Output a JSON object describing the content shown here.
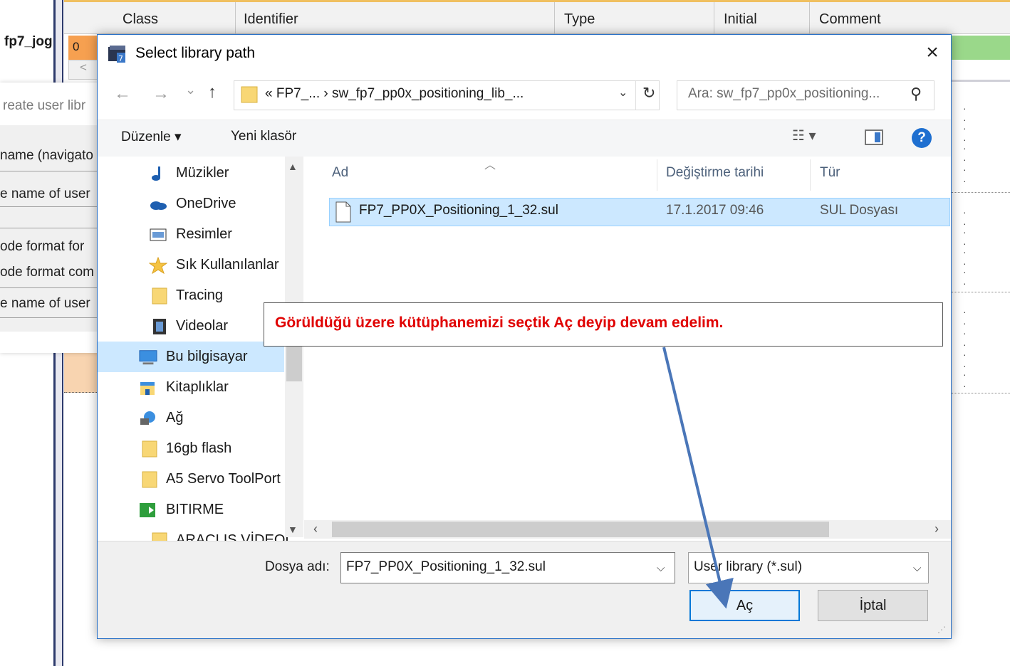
{
  "background_app": {
    "columns": [
      "Class",
      "Identifier",
      "Type",
      "Initial",
      "Comment"
    ],
    "tab_label": "fp7_jog",
    "zero_cell": "0",
    "scroll_left": "<",
    "create_title": "reate user libr",
    "create_lines": [
      "name (navigato",
      "e name of user",
      "ode format for",
      "ode format com",
      "e name of user"
    ]
  },
  "dialog": {
    "title": "Select library path",
    "close": "×",
    "nav": {
      "back": "←",
      "forward": "→",
      "recent": "⌄",
      "up": "↑"
    },
    "address": "« FP7_...  ›  sw_fp7_pp0x_positioning_lib_...",
    "search_placeholder": "Ara: sw_fp7_pp0x_positioning...",
    "toolbar": {
      "organize": "Düzenle ▾",
      "new_folder": "Yeni klasör"
    },
    "nav_items": [
      {
        "label": "Müzikler",
        "icon": "music-icon"
      },
      {
        "label": "OneDrive",
        "icon": "cloud-icon"
      },
      {
        "label": "Resimler",
        "icon": "pictures-icon"
      },
      {
        "label": "Sık Kullanılanlar",
        "icon": "star-icon"
      },
      {
        "label": "Tracing",
        "icon": "folder-icon"
      },
      {
        "label": "Videolar",
        "icon": "video-icon"
      },
      {
        "label": "Bu bilgisayar",
        "icon": "computer-icon",
        "selected": true
      },
      {
        "label": "Kitaplıklar",
        "icon": "library-icon"
      },
      {
        "label": "Ağ",
        "icon": "network-icon"
      },
      {
        "label": "16gb flash",
        "icon": "folder-icon"
      },
      {
        "label": "A5 Servo ToolPort",
        "icon": "folder-icon"
      },
      {
        "label": "BITIRME",
        "icon": "shortcut-icon"
      },
      {
        "label": "ARAÇLIS VİDEOL",
        "icon": "folder-icon"
      }
    ],
    "columns": {
      "name": "Ad",
      "modified": "Değiştirme tarihi",
      "type": "Tür"
    },
    "files": [
      {
        "name": "FP7_PP0X_Positioning_1_32.sul",
        "modified": "17.1.2017 09:46",
        "type": "SUL Dosyası"
      }
    ],
    "filename_label": "Dosya adı:",
    "filename_value": "FP7_PP0X_Positioning_1_32.sul",
    "filetype_value": "User library (*.sul)",
    "open_button": "Aç",
    "cancel_button": "İptal"
  },
  "annotation": {
    "text": "Görüldüğü üzere kütüphanemizi seçtik Aç deyip devam edelim.",
    "color": "#e00000",
    "arrow_color": "#4a76b8"
  }
}
